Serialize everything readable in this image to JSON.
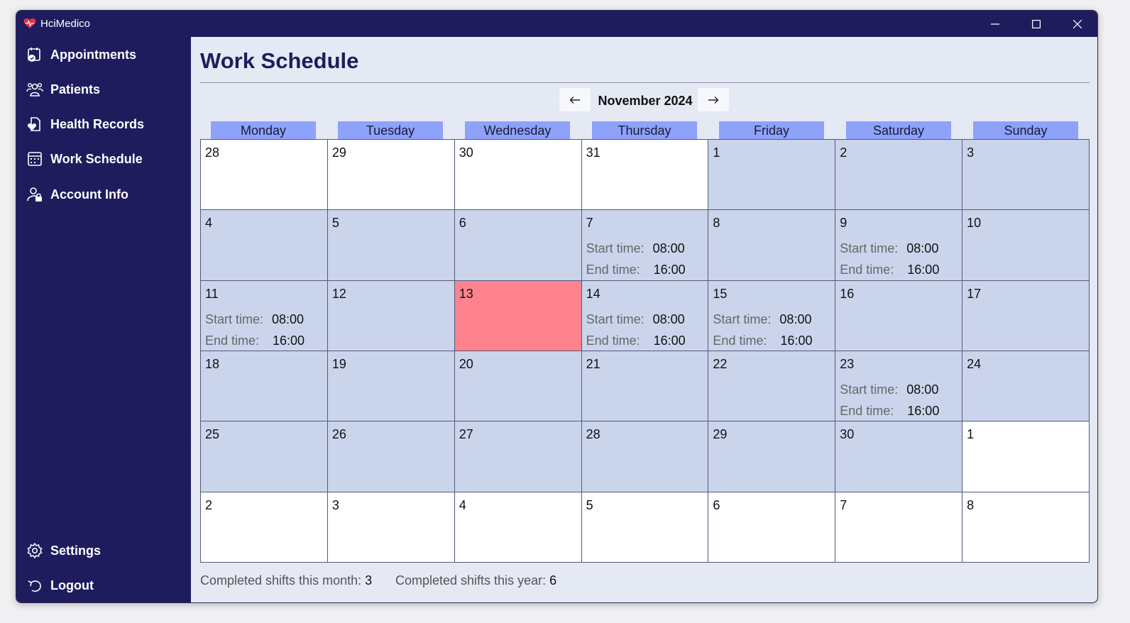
{
  "app": {
    "title": "HciMedico",
    "accent": "#1f1c5e",
    "today_color": "#fe838f",
    "header_color": "#8ea2fa"
  },
  "nav": {
    "items": [
      {
        "label": "Appointments",
        "icon": "appointment-icon"
      },
      {
        "label": "Patients",
        "icon": "patients-icon"
      },
      {
        "label": "Health Records",
        "icon": "health-records-icon"
      },
      {
        "label": "Work Schedule",
        "icon": "calendar-icon"
      },
      {
        "label": "Account Info",
        "icon": "account-icon"
      }
    ],
    "bottom": [
      {
        "label": "Settings",
        "icon": "gear-icon"
      },
      {
        "label": "Logout",
        "icon": "logout-icon"
      }
    ]
  },
  "page": {
    "title": "Work Schedule",
    "month": "November 2024"
  },
  "weekdays": [
    "Monday",
    "Tuesday",
    "Wednesday",
    "Thursday",
    "Friday",
    "Saturday",
    "Sunday"
  ],
  "shift_labels": {
    "start": "Start time:",
    "end": "End time:"
  },
  "days": [
    {
      "day": "28",
      "state": "other"
    },
    {
      "day": "29",
      "state": "other"
    },
    {
      "day": "30",
      "state": "other"
    },
    {
      "day": "31",
      "state": "other"
    },
    {
      "day": "1",
      "state": "cur"
    },
    {
      "day": "2",
      "state": "cur"
    },
    {
      "day": "3",
      "state": "cur"
    },
    {
      "day": "4",
      "state": "cur"
    },
    {
      "day": "5",
      "state": "cur"
    },
    {
      "day": "6",
      "state": "cur"
    },
    {
      "day": "7",
      "state": "cur",
      "start": "08:00",
      "end": "16:00"
    },
    {
      "day": "8",
      "state": "cur"
    },
    {
      "day": "9",
      "state": "cur",
      "start": "08:00",
      "end": "16:00"
    },
    {
      "day": "10",
      "state": "cur"
    },
    {
      "day": "11",
      "state": "cur",
      "start": "08:00",
      "end": "16:00"
    },
    {
      "day": "12",
      "state": "cur"
    },
    {
      "day": "13",
      "state": "today"
    },
    {
      "day": "14",
      "state": "cur",
      "start": "08:00",
      "end": "16:00"
    },
    {
      "day": "15",
      "state": "cur",
      "start": "08:00",
      "end": "16:00"
    },
    {
      "day": "16",
      "state": "cur"
    },
    {
      "day": "17",
      "state": "cur"
    },
    {
      "day": "18",
      "state": "cur"
    },
    {
      "day": "19",
      "state": "cur"
    },
    {
      "day": "20",
      "state": "cur"
    },
    {
      "day": "21",
      "state": "cur"
    },
    {
      "day": "22",
      "state": "cur"
    },
    {
      "day": "23",
      "state": "cur",
      "start": "08:00",
      "end": "16:00"
    },
    {
      "day": "24",
      "state": "cur"
    },
    {
      "day": "25",
      "state": "cur"
    },
    {
      "day": "26",
      "state": "cur"
    },
    {
      "day": "27",
      "state": "cur"
    },
    {
      "day": "28",
      "state": "cur"
    },
    {
      "day": "29",
      "state": "cur"
    },
    {
      "day": "30",
      "state": "cur"
    },
    {
      "day": "1",
      "state": "other"
    },
    {
      "day": "2",
      "state": "other"
    },
    {
      "day": "3",
      "state": "other"
    },
    {
      "day": "4",
      "state": "other"
    },
    {
      "day": "5",
      "state": "other"
    },
    {
      "day": "6",
      "state": "other"
    },
    {
      "day": "7",
      "state": "other"
    },
    {
      "day": "8",
      "state": "other"
    }
  ],
  "footer": {
    "month_label": "Completed shifts this month:",
    "month_value": "3",
    "year_label": "Completed shifts this year:",
    "year_value": "6"
  }
}
